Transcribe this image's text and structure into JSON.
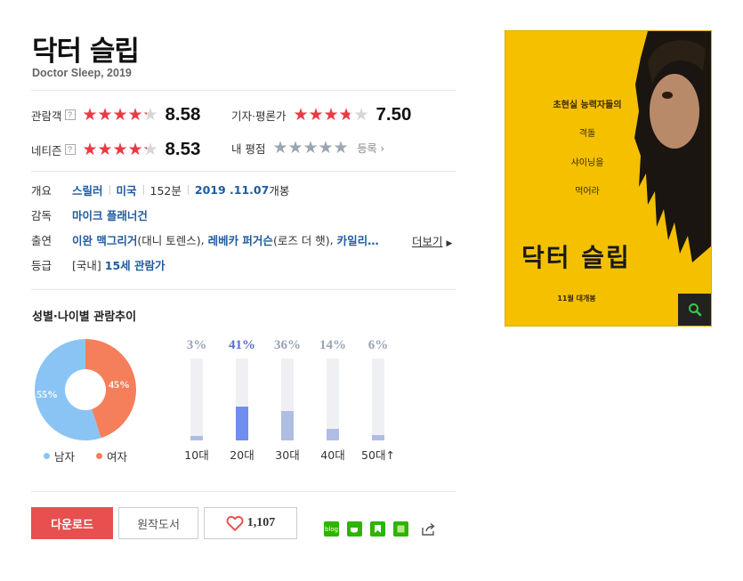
{
  "movie": {
    "title": "닥터 슬립",
    "subtitle": "Doctor Sleep, 2019"
  },
  "ratings": {
    "audience": {
      "label": "관람객",
      "help": "?",
      "score": "8.58",
      "stars": 8.58
    },
    "critic": {
      "label": "기자·평론가",
      "score": "7.50",
      "stars": 7.5
    },
    "netizen": {
      "label": "네티즌",
      "help": "?",
      "score": "8.53",
      "stars": 8.53
    },
    "mine": {
      "label": "내 평점",
      "action": "등록"
    }
  },
  "info": {
    "overview_label": "개요",
    "genre": "스릴러",
    "country": "미국",
    "runtime": "152분",
    "release_date": "2019 .11.07",
    "release_suffix": "개봉",
    "director_label": "감독",
    "director": "마이크 플래너건",
    "cast_label": "출연",
    "cast": [
      {
        "name": "이완 맥그리거",
        "role": "(대니 토렌스)"
      },
      {
        "name": "레베카 퍼거슨",
        "role": "(로즈 더 햇)"
      },
      {
        "name": "카일리…",
        "role": ""
      }
    ],
    "sep": ",",
    "more": "더보기",
    "grade_label": "등급",
    "grade_country": "[국내]",
    "grade": "15세 관람가"
  },
  "trend": {
    "title": "성별·나이별 관람추이",
    "gender": {
      "male_label": "남자",
      "female_label": "여자",
      "male_pct": 55,
      "female_pct": 45,
      "male_text": "55%",
      "female_text": "45%",
      "male_color": "#8ac4f4",
      "female_color": "#f57f5b"
    },
    "ages": [
      {
        "label": "10대",
        "pct_text": "3%",
        "pct": 3,
        "highlight": false
      },
      {
        "label": "20대",
        "pct_text": "41%",
        "pct": 41,
        "highlight": true
      },
      {
        "label": "30대",
        "pct_text": "36%",
        "pct": 36,
        "highlight": false
      },
      {
        "label": "40대",
        "pct_text": "14%",
        "pct": 14,
        "highlight": false
      },
      {
        "label": "50대↑",
        "pct_text": "6%",
        "pct": 6,
        "highlight": false
      }
    ],
    "highlight_color": "#6f8ef0",
    "highlight_text_color": "#5a6fc9",
    "bar_color": "#aebde4"
  },
  "actions": {
    "download": "다운로드",
    "book": "원작도서",
    "like_count": "1,107"
  },
  "share": {
    "blog_label": "blog",
    "icons": [
      "blog-icon",
      "cafe-icon",
      "bookmark-icon",
      "memo-icon",
      "share-icon"
    ]
  },
  "poster": {
    "tagline_1": "초현실 능력자들의",
    "tagline_2": "격돌",
    "tagline_3": "샤이닝을",
    "tagline_4": "먹어라",
    "title_art": "닥터 슬립",
    "release": "11월 대개봉"
  },
  "colors": {
    "star_red": "#ec3a45",
    "link_blue": "#1f5ba0",
    "download_red": "#e84f4f",
    "poster_yellow": "#f4c000"
  }
}
